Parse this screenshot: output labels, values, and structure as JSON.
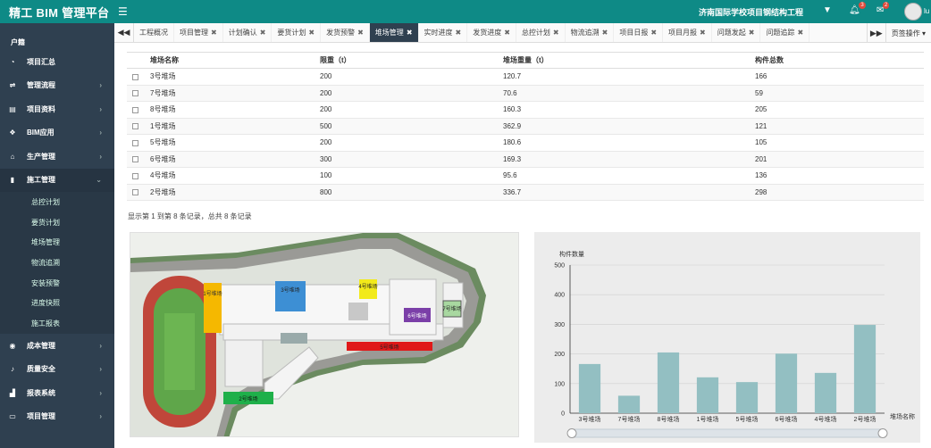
{
  "header": {
    "app_title": "精工 BIM 管理平台",
    "project_name": "济南国际学校项目钢结构工程",
    "bell_badge": "3",
    "mail_badge": "2",
    "user_name": "lu"
  },
  "sidebar": {
    "user_label": "户籍",
    "items": [
      {
        "label": "项目汇总",
        "icon": "dashboard-icon",
        "arrow": false
      },
      {
        "label": "管理流程",
        "icon": "flow-icon",
        "arrow": true
      },
      {
        "label": "项目资料",
        "icon": "database-icon",
        "arrow": true
      },
      {
        "label": "BIM应用",
        "icon": "cubes-icon",
        "arrow": true
      },
      {
        "label": "生产管理",
        "icon": "bank-icon",
        "arrow": true
      },
      {
        "label": "施工管理",
        "icon": "doc-icon",
        "arrow": true
      }
    ],
    "sub_items": [
      "总控计划",
      "要货计划",
      "堆场管理",
      "物流追溯",
      "安装预警",
      "进度快照",
      "施工报表"
    ],
    "items_after": [
      {
        "label": "成本管理",
        "icon": "cost-icon",
        "arrow": true
      },
      {
        "label": "质量安全",
        "icon": "bell-icon",
        "arrow": true
      },
      {
        "label": "报表系统",
        "icon": "bar-icon",
        "arrow": true
      },
      {
        "label": "项目管理",
        "icon": "monitor-icon",
        "arrow": true
      }
    ]
  },
  "tabs": {
    "items": [
      {
        "label": "工程概况",
        "closable": false
      },
      {
        "label": "项目管理",
        "closable": true
      },
      {
        "label": "计划确认",
        "closable": true
      },
      {
        "label": "要货计划",
        "closable": true
      },
      {
        "label": "发货预警",
        "closable": true
      },
      {
        "label": "堆场管理",
        "closable": true,
        "active": true
      },
      {
        "label": "实时进度",
        "closable": true
      },
      {
        "label": "发货进度",
        "closable": true
      },
      {
        "label": "总控计划",
        "closable": true
      },
      {
        "label": "物流追溯",
        "closable": true
      },
      {
        "label": "项目日报",
        "closable": true
      },
      {
        "label": "项目月报",
        "closable": true
      },
      {
        "label": "问题发起",
        "closable": true
      },
      {
        "label": "问题追踪",
        "closable": true
      }
    ],
    "page_ops_label": "页签操作"
  },
  "table": {
    "columns": [
      "堆场名称",
      "限重（t）",
      "堆场重量（t）",
      "构件总数"
    ],
    "rows": [
      [
        "3号堆场",
        "200",
        "120.7",
        "166"
      ],
      [
        "7号堆场",
        "200",
        "70.6",
        "59"
      ],
      [
        "8号堆场",
        "200",
        "160.3",
        "205"
      ],
      [
        "1号堆场",
        "500",
        "362.9",
        "121"
      ],
      [
        "5号堆场",
        "200",
        "180.6",
        "105"
      ],
      [
        "6号堆场",
        "300",
        "169.3",
        "201"
      ],
      [
        "4号堆场",
        "100",
        "95.6",
        "136"
      ],
      [
        "2号堆场",
        "800",
        "336.7",
        "298"
      ]
    ],
    "summary": "显示第 1 到第 8 条记录，总共 8 条记录"
  },
  "site_map": {
    "labels": {
      "yard1": "1号堆场",
      "yard2": "2号堆场",
      "yard3": "3号堆场",
      "yard4": "4号堆场",
      "yard6": "6号堆场",
      "yard7": "7号堆场",
      "yard_red": "5号堆场"
    },
    "colors": {
      "yard1": "#f5b800",
      "yard2": "#1fb04a",
      "yard3": "#3d8fd4",
      "yard4": "#f2ea1a",
      "yard6": "#7b3fa8",
      "yard7": "#a8d8a0",
      "yard_red": "#e01919"
    }
  },
  "chart_data": {
    "type": "bar",
    "categories": [
      "3号堆场",
      "7号堆场",
      "8号堆场",
      "1号堆场",
      "5号堆场",
      "6号堆场",
      "4号堆场",
      "2号堆场"
    ],
    "values": [
      166,
      59,
      205,
      121,
      105,
      201,
      136,
      298
    ],
    "ylabel": "构件数量",
    "xlabel": "堆场名称",
    "ylim": [
      0,
      500
    ],
    "yticks": [
      "0",
      "100",
      "200",
      "300",
      "400",
      "500"
    ],
    "grid": true,
    "bar_color": "#93bfc2"
  }
}
